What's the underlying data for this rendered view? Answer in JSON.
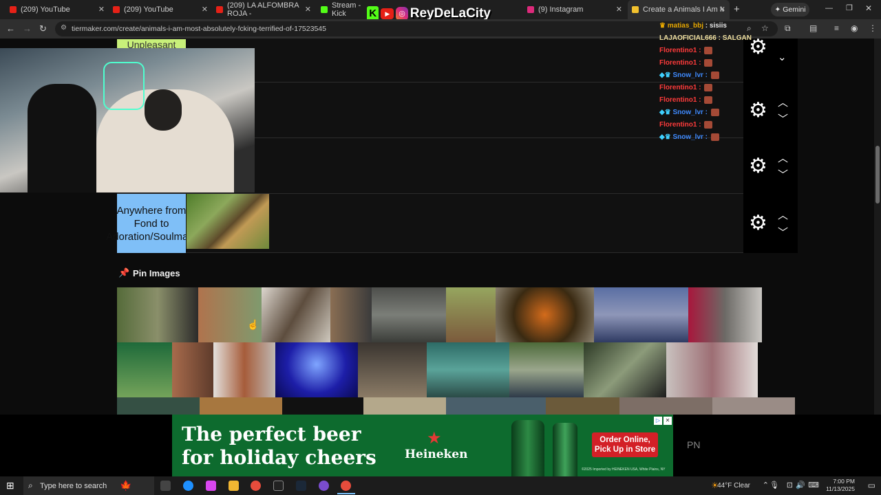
{
  "tabs": [
    {
      "label": "(209) YouTube",
      "color": "#e62117"
    },
    {
      "label": "(209) YouTube",
      "color": "#e62117"
    },
    {
      "label": "(209) LA ALFOMBRA ROJA -",
      "color": "#e62117"
    },
    {
      "label": "Stream - Kick",
      "color": "#53fc18"
    },
    {
      "label": "(9) Instagram",
      "color": "#dd2a7b"
    },
    {
      "label": "Create a Animals I Am Most",
      "color": "#f2c12e"
    }
  ],
  "gemini_label": "Gemini",
  "url": "tiermaker.com/create/animals-i-am-most-absolutely-fcking-terrified-of-17523545",
  "overlay_name": "ReyDeLaCity",
  "tiers": {
    "unpleasant": "Unpleasant",
    "anywhere": "Anywhere from Fond to Adoration/Soulmate"
  },
  "pin_images_title": "Pin Images",
  "chat": [
    {
      "user": "matias_bbj",
      "text": "sisiis",
      "color": "#e8a800",
      "emote": false
    },
    {
      "user": "LAJAOFICIAL666",
      "text": "SALGAN",
      "color": "#f0e0a0",
      "emote": false
    },
    {
      "user": "Florentino1",
      "text": "",
      "color": "#ff3b3b",
      "emote": true
    },
    {
      "user": "Florentino1",
      "text": "",
      "color": "#ff3b3b",
      "emote": true
    },
    {
      "user": "Snow_lvr",
      "text": "",
      "color": "#3f8bff",
      "emote": true
    },
    {
      "user": "Florentino1",
      "text": "",
      "color": "#ff3b3b",
      "emote": true
    },
    {
      "user": "Florentino1",
      "text": "",
      "color": "#ff3b3b",
      "emote": true
    },
    {
      "user": "Snow_lvr",
      "text": "",
      "color": "#3f8bff",
      "emote": true
    },
    {
      "user": "Florentino1",
      "text": "",
      "color": "#ff3b3b",
      "emote": true
    },
    {
      "user": "Snow_lvr",
      "text": "",
      "color": "#3f8bff",
      "emote": true
    }
  ],
  "ad": {
    "line1": "The perfect beer",
    "line2": "for holiday cheers",
    "brand": "Heineken",
    "cta": "Order Online, Pick Up in Store",
    "fine_print": "©2025 Imported by HEINEKEN USA, White Plains, NY",
    "side_text": "PN"
  },
  "taskbar": {
    "search_placeholder": "Type here to search",
    "weather": "44°F  Clear",
    "time": "7:00 PM",
    "date": "11/13/2025"
  }
}
